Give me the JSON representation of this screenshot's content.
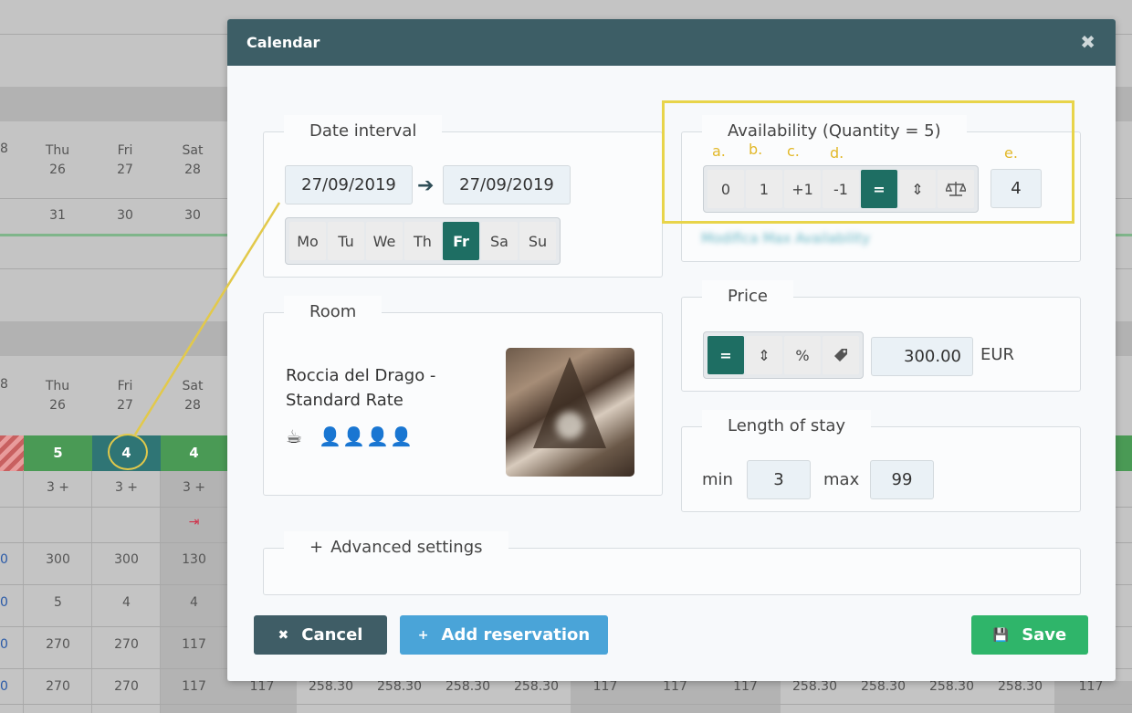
{
  "background": {
    "top_header": {
      "stub": "8",
      "days": [
        {
          "day": "Thu",
          "date": "26"
        },
        {
          "day": "Fri",
          "date": "27"
        },
        {
          "day": "Sat",
          "date": "28"
        }
      ]
    },
    "top_row": {
      "values": [
        "31",
        "30",
        "30"
      ]
    },
    "bottom_header": {
      "stub": "8",
      "days": [
        {
          "day": "Thu",
          "date": "26"
        },
        {
          "day": "Fri",
          "date": "27"
        },
        {
          "day": "Sat",
          "date": "28"
        }
      ]
    },
    "avail_row": [
      "5",
      "4",
      "4"
    ],
    "minstay_row": [
      "3 +",
      "3 +",
      "3 +"
    ],
    "price_row": {
      "stub": "0",
      "values": [
        "300",
        "300",
        "130"
      ]
    },
    "qty_row": {
      "stub": "0",
      "values": [
        "5",
        "4",
        "4"
      ]
    },
    "row_270a": {
      "stub": "0",
      "values": [
        "270",
        "270",
        "117"
      ]
    },
    "row_270b": {
      "stub": "0",
      "values": [
        "270",
        "270",
        "117",
        "117",
        "258.30",
        "258.30",
        "258.30",
        "258.30",
        "117",
        "117",
        "117",
        "258.30",
        "258.30",
        "258.30",
        "258.30",
        "117"
      ]
    }
  },
  "modal": {
    "title": "Calendar",
    "date_interval": {
      "legend": "Date interval",
      "from": "27/09/2019",
      "to": "27/09/2019",
      "weekdays": [
        "Mo",
        "Tu",
        "We",
        "Th",
        "Fr",
        "Sa",
        "Su"
      ],
      "selected_weekday": "Fr"
    },
    "availability": {
      "legend": "Availability (Quantity = 5)",
      "buttons": [
        "0",
        "1",
        "+1",
        "-1",
        "=",
        "⇕",
        "balance-icon"
      ],
      "active": "=",
      "value": "4",
      "annotations": [
        "a.",
        "b.",
        "c.",
        "d.",
        "e."
      ],
      "blurred_text": "Modifica Max Availability"
    },
    "room": {
      "legend": "Room",
      "name": "Roccia del Drago - Standard Rate",
      "icons": [
        "coffee-cup-icon",
        "person-icon",
        "person-icon",
        "person-icon",
        "person-icon"
      ]
    },
    "price": {
      "legend": "Price",
      "buttons": [
        "=",
        "⇕",
        "%",
        "tag-icon"
      ],
      "active": "=",
      "value": "300.00",
      "currency": "EUR"
    },
    "length_of_stay": {
      "legend": "Length of stay",
      "min_label": "min",
      "min_value": "3",
      "max_label": "max",
      "max_value": "99"
    },
    "advanced": {
      "label": "Advanced settings",
      "icon": "plus-icon"
    },
    "footer": {
      "cancel": "Cancel",
      "add_reservation": "Add reservation",
      "save": "Save"
    }
  },
  "colors": {
    "header": "#3d5e66",
    "active_button": "#1e6e63",
    "annotation": "#e8d44a",
    "cancel": "#3f5d66",
    "add": "#4aa4d8",
    "save": "#2fb56a",
    "availability_green": "#4a9a55"
  }
}
